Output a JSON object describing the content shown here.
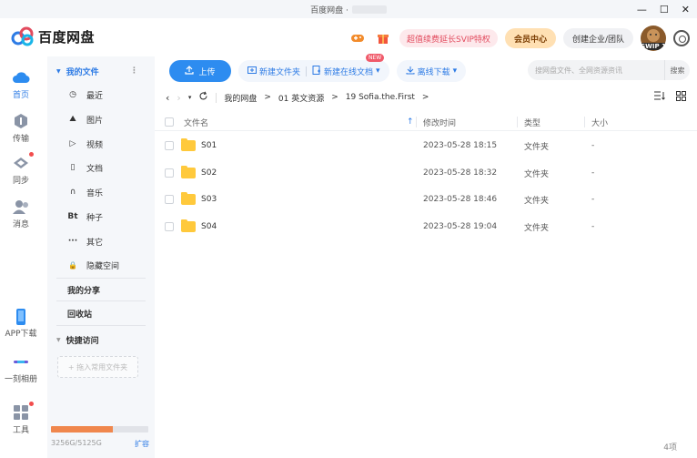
{
  "window": {
    "title": "百度网盘 ·",
    "controls": {
      "minimize": "—",
      "maximize": "☐",
      "close": "✕"
    }
  },
  "header": {
    "logo_text": "百度网盘",
    "game_icon": "gamepad-icon",
    "gift_icon": "gift-icon",
    "svip_promo": "超值续费延长SVIP特权",
    "vip_center": "会员中心",
    "team": "创建企业/团队",
    "avatar_tag": "SWIP 1",
    "settings_icon": "settings-icon"
  },
  "rail": {
    "items": [
      {
        "label": "首页",
        "icon": "cloud-home-icon",
        "active": true
      },
      {
        "label": "传输",
        "icon": "transfer-icon"
      },
      {
        "label": "同步",
        "icon": "sync-icon",
        "badge": true
      },
      {
        "label": "消息",
        "icon": "message-icon"
      },
      {
        "label": "APP下载",
        "icon": "phone-icon"
      },
      {
        "label": "一刻相册",
        "icon": "album-icon"
      },
      {
        "label": "工具",
        "icon": "tools-icon",
        "badge": true
      }
    ]
  },
  "sidebar": {
    "my_files": "我的文件",
    "more": "⋮",
    "categories": [
      {
        "label": "最近",
        "icon": "clock-icon",
        "glyph": "◷"
      },
      {
        "label": "图片",
        "icon": "image-icon",
        "glyph": "⛰"
      },
      {
        "label": "视频",
        "icon": "video-icon",
        "glyph": "▷"
      },
      {
        "label": "文档",
        "icon": "document-icon",
        "glyph": "▯"
      },
      {
        "label": "音乐",
        "icon": "music-icon",
        "glyph": "∩"
      },
      {
        "label": "种子",
        "icon": "torrent-icon",
        "glyph": "Bt"
      },
      {
        "label": "其它",
        "icon": "other-icon",
        "glyph": "···"
      },
      {
        "label": "隐藏空间",
        "icon": "lock-icon",
        "glyph": "🔒"
      }
    ],
    "my_share": "我的分享",
    "recycle": "回收站",
    "quick_access": "快捷访问",
    "drag_placeholder": "+ 拖入常用文件夹",
    "storage": {
      "used_text": "3256G/5125G",
      "used_fraction": 0.635,
      "expand": "扩容"
    }
  },
  "toolbar": {
    "upload": "上传",
    "new_folder": "新建文件夹",
    "new_doc": "新建在线文档",
    "new_badge": "NEW",
    "offline": "离线下载",
    "search_placeholder": "搜网盘文件、全网资源资讯",
    "search_button": "搜索"
  },
  "breadcrumb": {
    "items": [
      "我的网盘",
      "01 英文资源",
      "19 Sofia.the.First"
    ],
    "sep": ">"
  },
  "table": {
    "headers": {
      "name": "文件名",
      "modified": "修改时间",
      "type": "类型",
      "size": "大小"
    },
    "rows": [
      {
        "name": "S01",
        "modified": "2023-05-28 18:15",
        "type": "文件夹",
        "size": "-"
      },
      {
        "name": "S02",
        "modified": "2023-05-28 18:32",
        "type": "文件夹",
        "size": "-"
      },
      {
        "name": "S03",
        "modified": "2023-05-28 18:46",
        "type": "文件夹",
        "size": "-"
      },
      {
        "name": "S04",
        "modified": "2023-05-28 19:04",
        "type": "文件夹",
        "size": "-"
      }
    ],
    "count": "4项"
  },
  "colors": {
    "accent": "#2d7be5",
    "folder": "#ffc93c",
    "storage_fill": "#f0874d"
  }
}
